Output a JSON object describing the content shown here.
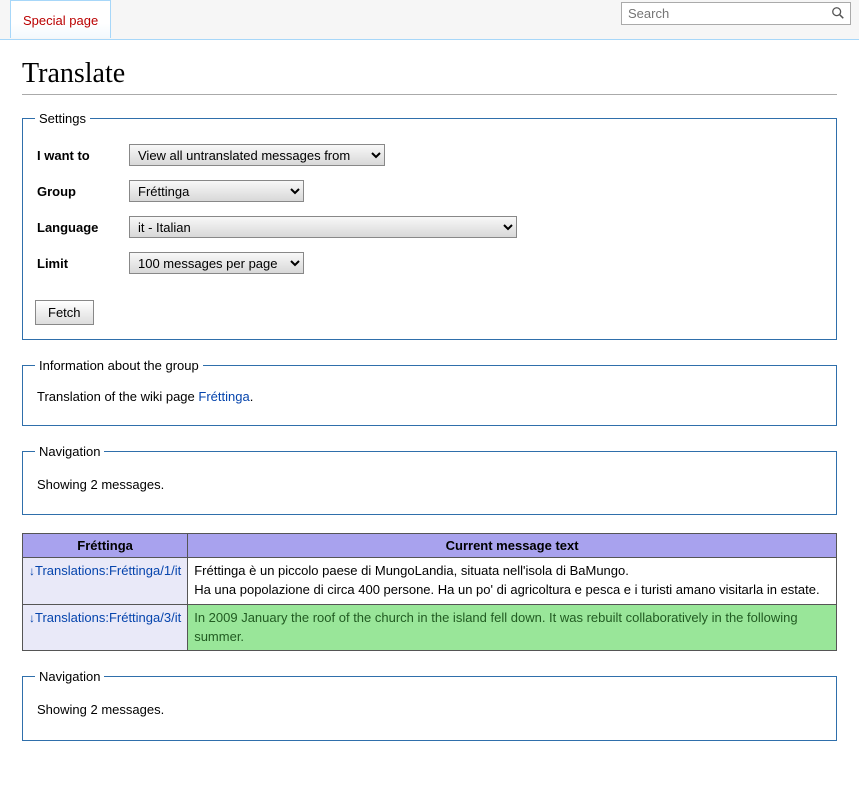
{
  "top": {
    "tab": "Special page",
    "search_placeholder": "Search"
  },
  "heading": "Translate",
  "settings": {
    "legend": "Settings",
    "labels": {
      "iwant": "I want to",
      "group": "Group",
      "language": "Language",
      "limit": "Limit"
    },
    "iwant_value": "View all untranslated messages from",
    "group_value": "Fréttinga",
    "language_value": "it - Italian",
    "limit_value": "100 messages per page",
    "fetch": "Fetch"
  },
  "groupinfo": {
    "legend": "Information about the group",
    "prefix": "Translation of the wiki page ",
    "link": "Fréttinga",
    "suffix": "."
  },
  "nav": {
    "legend": "Navigation",
    "text": "Showing 2 messages."
  },
  "table": {
    "header_group": "Fréttinga",
    "header_msg": "Current message text",
    "rows": [
      {
        "link": "Translations:Fréttinga/1/it",
        "text": "Fréttinga è un piccolo paese di MungoLandia, situata nell'isola di BaMungo.\nHa una popolazione di circa 400 persone. Ha un po' di agricoltura e pesca e i turisti amano visitarla in estate.",
        "cls": "msg-text-normal"
      },
      {
        "link": "Translations:Fréttinga/3/it",
        "text": "In 2009 January the roof of the church in the island fell down. It was rebuilt collaboratively in the following summer.",
        "cls": "msg-text-green"
      }
    ]
  }
}
